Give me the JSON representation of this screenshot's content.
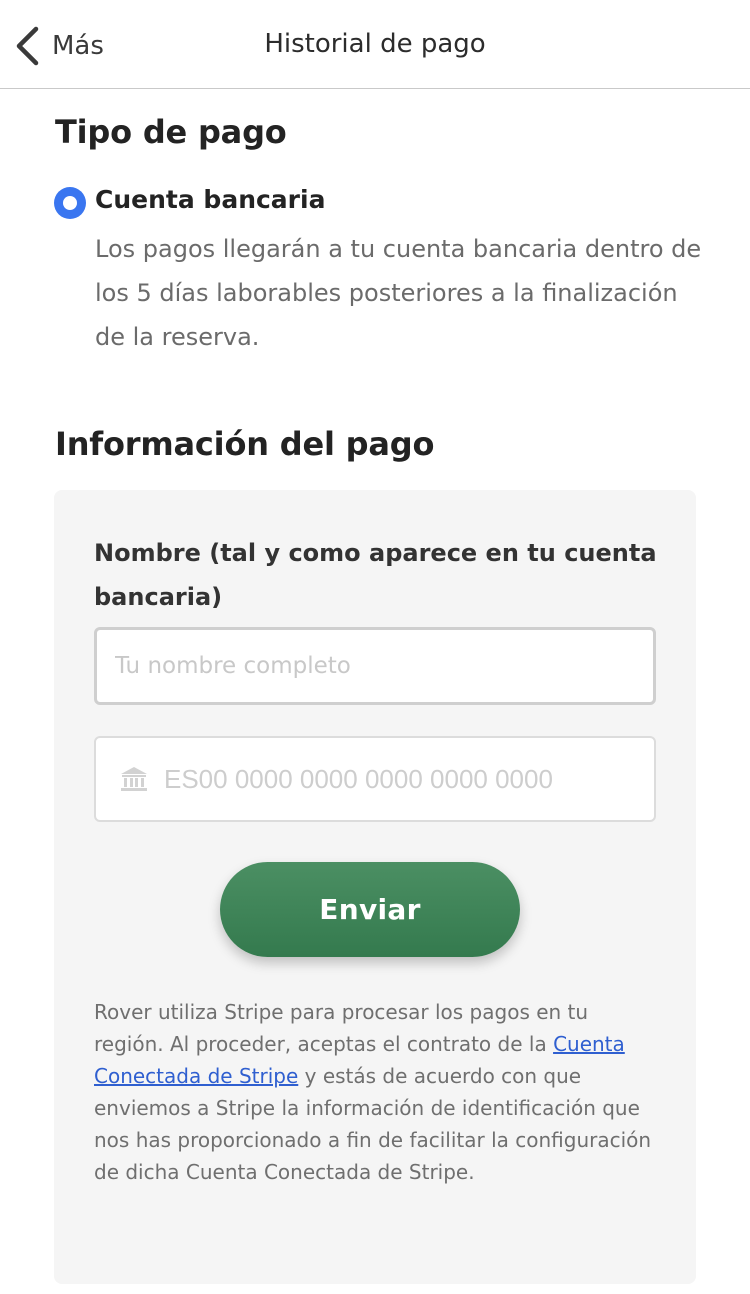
{
  "nav": {
    "back_label": "Más",
    "title": "Historial de pago"
  },
  "payment_type": {
    "heading": "Tipo de pago",
    "option_label": "Cuenta bancaria",
    "option_desc": "Los pagos llegarán a tu cuenta bancaria dentro de los 5 días laborables posteriores a la finalización de la reserva.",
    "selected": true
  },
  "payment_info": {
    "heading": "Información del pago",
    "name_label": "Nombre (tal y como aparece en tu cuenta bancaria)",
    "name_placeholder": "Tu nombre completo",
    "name_value": "",
    "iban_placeholder": "ES00 0000 0000 0000 0000 0000",
    "iban_value": "",
    "submit_label": "Enviar"
  },
  "legal": {
    "text_before": "Rover utiliza Stripe para procesar los pagos en tu región. Al proceder, aceptas el contrato de la ",
    "link_text": "Cuenta Conectada de Stripe",
    "text_after": " y estás de acuerdo con que enviemos a Stripe la información de identificación que nos has proporcionado a fin de facilitar la configuración de dicha Cuenta Conectada de Stripe."
  },
  "colors": {
    "accent_radio": "#3a76f0",
    "button_green": "#3d8358",
    "link_blue": "#2f5fd0"
  },
  "icons": {
    "back": "chevron-left-icon",
    "bank": "bank-icon"
  }
}
